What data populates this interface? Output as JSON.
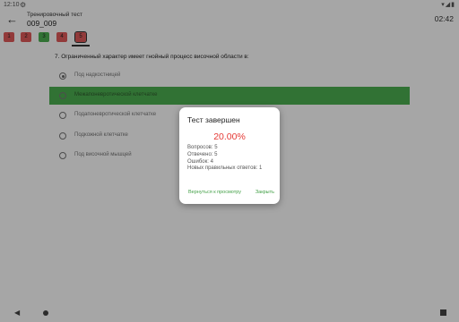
{
  "status_bar": {
    "time": "12:10",
    "gear_icon": "⚙",
    "right_icons": "▾◢▮"
  },
  "app_bar": {
    "title": "Тренировочный тест",
    "subtitle": "009_009",
    "timer": "02:42",
    "back_icon": "←"
  },
  "question_nav": [
    {
      "label": "1",
      "status": "red"
    },
    {
      "label": "2",
      "status": "red"
    },
    {
      "label": "3",
      "status": "green"
    },
    {
      "label": "4",
      "status": "red"
    },
    {
      "label": "5",
      "status": "red"
    }
  ],
  "question": {
    "text": "7. Ограниченный характер имеет гнойный процесс височной  области в:",
    "options": [
      {
        "label": "Под надкостницей",
        "selected": true,
        "correct": false
      },
      {
        "label": "Межапоневротической клетчатке",
        "selected": false,
        "correct": true
      },
      {
        "label": "Подапоневротической клетчатке",
        "selected": false,
        "correct": false
      },
      {
        "label": "Подкожной клетчатке",
        "selected": false,
        "correct": false
      },
      {
        "label": "Под височной мышцей",
        "selected": false,
        "correct": false
      }
    ]
  },
  "dialog": {
    "title": "Тест завершен",
    "score": "20.00%",
    "stats": {
      "questions": "Вопросов: 5",
      "answered": "Отвечено: 5",
      "errors": "Ошибок: 4",
      "new_correct": "Новых правильных ответов: 1"
    },
    "review_button": "Вернуться к просмотру",
    "close_button": "Закрыть"
  },
  "nav_bar": {
    "back_icon": "◀"
  },
  "colors": {
    "accent_green": "#4caf50",
    "score_red": "#e53935",
    "wrong_red": "#e05a5a"
  }
}
